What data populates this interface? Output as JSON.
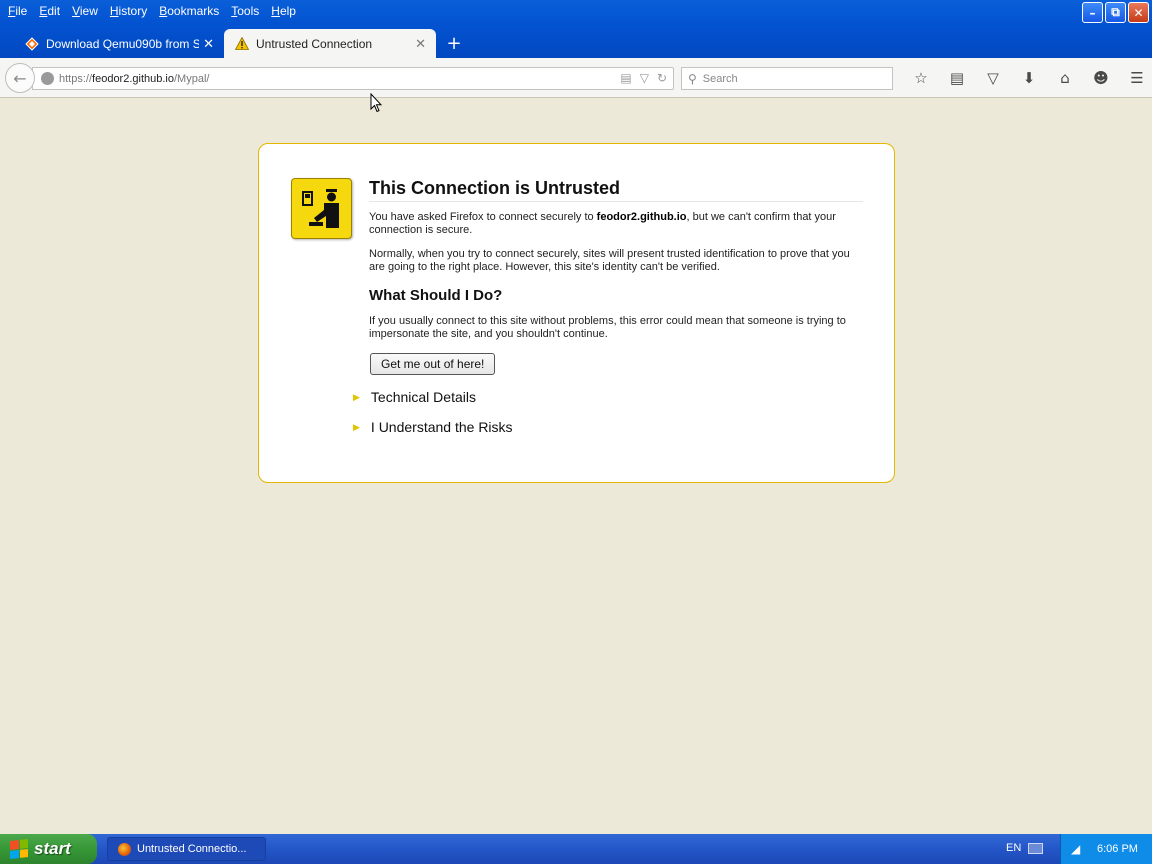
{
  "menubar": {
    "items": [
      "File",
      "Edit",
      "View",
      "History",
      "Bookmarks",
      "Tools",
      "Help"
    ]
  },
  "tabs": [
    {
      "label": "Download Qemu090b from So...",
      "icon": "sourceforge-icon",
      "active": false
    },
    {
      "label": "Untrusted Connection",
      "icon": "warning-icon",
      "active": true
    }
  ],
  "navbar": {
    "url_prefix": "https://",
    "url_host": "feodor2.github.io",
    "url_path": "/Mypal/",
    "search_placeholder": "Search"
  },
  "error": {
    "title": "This Connection is Untrusted",
    "intro_before": "You have asked Firefox to connect securely to ",
    "intro_host": "feodor2.github.io",
    "intro_after": ", but we can't confirm that your connection is secure.",
    "normally": "Normally, when you try to connect securely, sites will present trusted identification to prove that you are going to the right place. However, this site's identity can't be verified.",
    "what_heading": "What Should I Do?",
    "what_text": "If you usually connect to this site without problems, this error could mean that someone is trying to impersonate the site, and you shouldn't continue.",
    "get_out_button": "Get me out of here!",
    "technical_details": "Technical Details",
    "understand_risks": "I Understand the Risks"
  },
  "taskbar": {
    "start_label": "start",
    "task_item": "Untrusted Connectio...",
    "language": "EN",
    "clock": "6:06 PM"
  },
  "colors": {
    "titlebar_blue": "#0353d1",
    "error_border": "#e4b700",
    "icon_yellow": "#f5d80e",
    "start_green": "#379837"
  }
}
